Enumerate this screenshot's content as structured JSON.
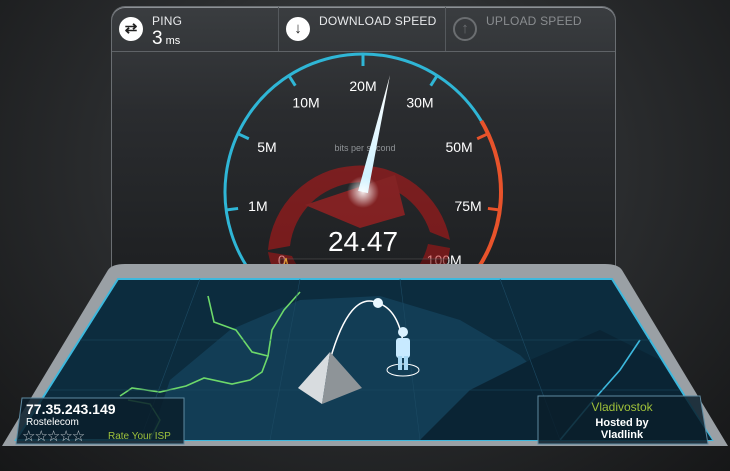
{
  "stats": {
    "ping": {
      "label": "PING",
      "value": "3",
      "unit": "ms",
      "icon": "ping-arrows-icon"
    },
    "download": {
      "label": "DOWNLOAD SPEED",
      "icon": "download-arrow-icon"
    },
    "upload": {
      "label": "UPLOAD SPEED",
      "icon": "upload-arrow-icon"
    }
  },
  "gauge": {
    "ticks": [
      "0",
      "1M",
      "5M",
      "10M",
      "20M",
      "30M",
      "50M",
      "75M",
      "100M"
    ],
    "unit_label": "bits per second",
    "current_value": "24.47",
    "needle_position": 4.4
  },
  "client": {
    "ip": "77.35.243.149",
    "isp": "Rostelecom",
    "rating_stars": 5,
    "rate_label": "Rate Your ISP"
  },
  "server": {
    "city": "Vladivostok",
    "hosted_label": "Hosted by",
    "host": "Vladlink"
  },
  "colors": {
    "gauge_blue": "#2fb6d6",
    "gauge_red": "#e8532b",
    "map_green": "#6dd96a",
    "accent_green": "#9fc13a"
  }
}
